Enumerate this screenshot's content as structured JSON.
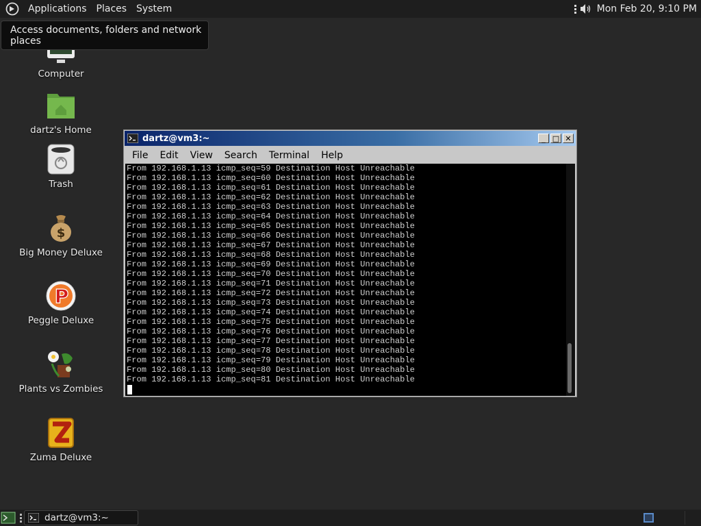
{
  "top_panel": {
    "menus": [
      "Applications",
      "Places",
      "System"
    ],
    "clock": "Mon Feb 20,  9:10 PM",
    "icons": [
      "foot-menu-icon",
      "panel-grip-icon",
      "volume-icon"
    ]
  },
  "tooltip": {
    "text": "Access documents, folders and network places"
  },
  "desktop_icons": [
    {
      "label": "Computer",
      "icon": "computer-icon"
    },
    {
      "label": "dartz's Home",
      "icon": "home-folder-icon"
    },
    {
      "label": "Trash",
      "icon": "trash-icon"
    },
    {
      "label": "Big Money Deluxe",
      "icon": "money-bag-icon"
    },
    {
      "label": "Peggle Deluxe",
      "icon": "peggle-icon"
    },
    {
      "label": "Plants vs Zombies",
      "icon": "plants-vs-zombies-icon"
    },
    {
      "label": "Zuma Deluxe",
      "icon": "zuma-icon"
    }
  ],
  "terminal": {
    "title": "dartz@vm3:~",
    "menu": [
      "File",
      "Edit",
      "View",
      "Search",
      "Terminal",
      "Help"
    ],
    "window_buttons": [
      "_",
      "□",
      "✕"
    ],
    "lines": [
      "From 192.168.1.13 icmp_seq=59 Destination Host Unreachable",
      "From 192.168.1.13 icmp_seq=60 Destination Host Unreachable",
      "From 192.168.1.13 icmp_seq=61 Destination Host Unreachable",
      "From 192.168.1.13 icmp_seq=62 Destination Host Unreachable",
      "From 192.168.1.13 icmp_seq=63 Destination Host Unreachable",
      "From 192.168.1.13 icmp_seq=64 Destination Host Unreachable",
      "From 192.168.1.13 icmp_seq=65 Destination Host Unreachable",
      "From 192.168.1.13 icmp_seq=66 Destination Host Unreachable",
      "From 192.168.1.13 icmp_seq=67 Destination Host Unreachable",
      "From 192.168.1.13 icmp_seq=68 Destination Host Unreachable",
      "From 192.168.1.13 icmp_seq=69 Destination Host Unreachable",
      "From 192.168.1.13 icmp_seq=70 Destination Host Unreachable",
      "From 192.168.1.13 icmp_seq=71 Destination Host Unreachable",
      "From 192.168.1.13 icmp_seq=72 Destination Host Unreachable",
      "From 192.168.1.13 icmp_seq=73 Destination Host Unreachable",
      "From 192.168.1.13 icmp_seq=74 Destination Host Unreachable",
      "From 192.168.1.13 icmp_seq=75 Destination Host Unreachable",
      "From 192.168.1.13 icmp_seq=76 Destination Host Unreachable",
      "From 192.168.1.13 icmp_seq=77 Destination Host Unreachable",
      "From 192.168.1.13 icmp_seq=78 Destination Host Unreachable",
      "From 192.168.1.13 icmp_seq=79 Destination Host Unreachable",
      "From 192.168.1.13 icmp_seq=80 Destination Host Unreachable",
      "From 192.168.1.13 icmp_seq=81 Destination Host Unreachable"
    ],
    "scroll_position": 1.0,
    "scroll_visible_fraction": 0.22
  },
  "bottom_panel": {
    "task_label": "dartz@vm3:~"
  },
  "colors": {
    "panel_bg": "#1e1e1e",
    "desktop_bg": "#282828",
    "titlebar_start": "#0a246a",
    "titlebar_end": "#a6caf0"
  }
}
